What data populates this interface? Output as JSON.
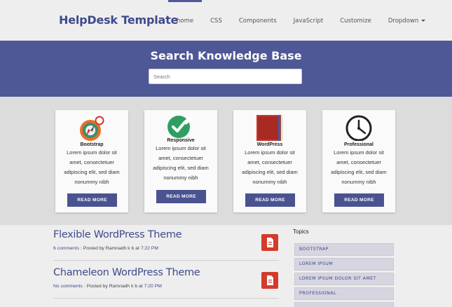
{
  "header": {
    "brand": "HelpDesk Template",
    "nav": [
      {
        "label": "home",
        "active": true
      },
      {
        "label": "CSS"
      },
      {
        "label": "Components"
      },
      {
        "label": "JavaScript"
      },
      {
        "label": "Customize"
      },
      {
        "label": "Dropdown",
        "dropdown": true
      }
    ]
  },
  "banner": {
    "title": "Search Knowledge Base",
    "search_placeholder": "Search"
  },
  "features": [
    {
      "title": "Bootstrap",
      "icon": "compass-icon",
      "text": [
        "Lorem ipsum dolor sit",
        "amet, consectetuer",
        "adipiscing elit, sed diam",
        "nonummy nibh"
      ],
      "button": "READ MORE"
    },
    {
      "title": "Responsive",
      "icon": "check-edit-icon",
      "text": [
        "Lorem ipsum dolor sit",
        "amet, consectetuer",
        "adipiscing elit, sed diam",
        "nonummy nibh"
      ],
      "button": "READ MORE"
    },
    {
      "title": "WordPress",
      "icon": "book-icon",
      "text": [
        "Lorem ipsum dolor sit",
        "amet, consectetuer",
        "adipiscing elit, sed diam",
        "nonummy nibh"
      ],
      "button": "READ MORE"
    },
    {
      "title": "Professional",
      "icon": "clock-icon",
      "text": [
        "Lorem ipsum dolor sit",
        "amet, consectetuer",
        "adipiscing elit, sed diam",
        "nonummy nibh"
      ],
      "button": "READ MORE"
    }
  ],
  "posts": [
    {
      "title": "Flexible WordPress Theme",
      "comments": "6 comments",
      "posted_by": " : Posted by Ramnadh k b at ",
      "time": "7:22 PM"
    },
    {
      "title": "Chameleon WordPress Theme",
      "comments": "No comments",
      "posted_by": " : Posted by Ramnadh k b at ",
      "time": "7:20 PM"
    }
  ],
  "topics": {
    "title": "Topics",
    "items": [
      "BOOTSTRAP",
      "LOREM IPSUM",
      "LOREM IPSUM DOLOR SIT AMET",
      "PROFESSIONAL",
      ""
    ]
  },
  "colors": {
    "brand": "#3d4a8c",
    "banner": "#4e5896",
    "button": "#4a5390",
    "post_icon": "#d23b2c"
  }
}
